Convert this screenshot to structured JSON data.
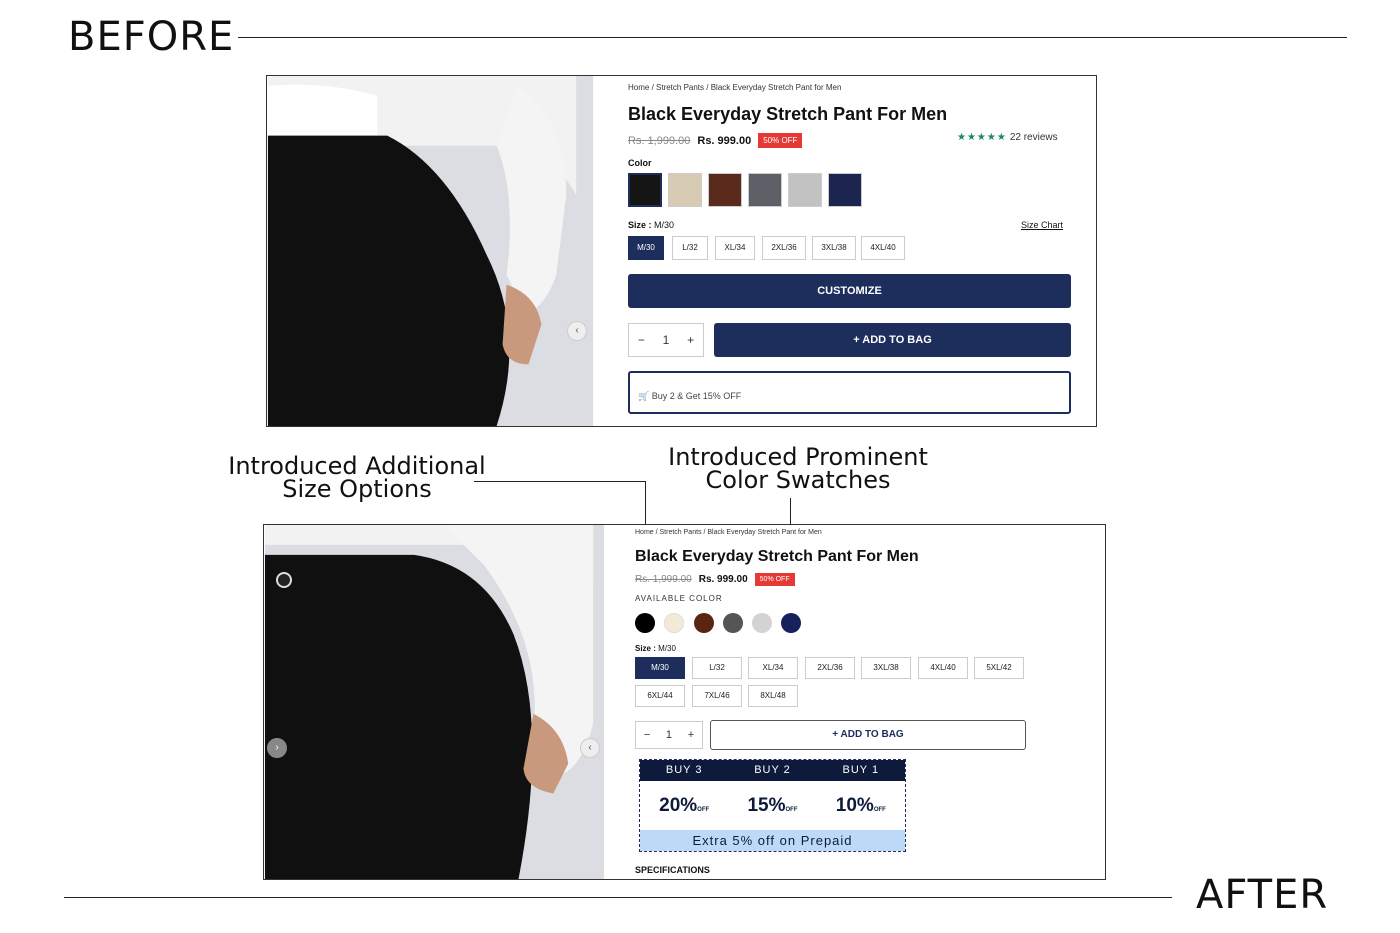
{
  "headings": {
    "before": "BEFORE",
    "after": "AFTER"
  },
  "annotations": {
    "sizes_line1": "Introduced Additional",
    "sizes_line2": "Size Options",
    "colors_line1": "Introduced Prominent",
    "colors_line2": "Color Swatches"
  },
  "before": {
    "breadcrumb": "Home / Stretch Pants / Black Everyday Stretch Pant for Men",
    "title": "Black Everyday Stretch Pant For Men",
    "old_price": "Rs. 1,999.00",
    "price": "Rs. 999.00",
    "badge": "50% OFF",
    "stars": "★★★★★",
    "reviews": "22 reviews",
    "color_label": "Color",
    "size_label": "Size :",
    "size_value": "M/30",
    "size_chart": "Size Chart",
    "sizes": [
      "M/30",
      "L/32",
      "XL/34",
      "2XL/36",
      "3XL/38",
      "4XL/40"
    ],
    "customize": "CUSTOMIZE",
    "qty": {
      "minus": "−",
      "value": "1",
      "plus": "+"
    },
    "add_to_bag": "+ ADD TO BAG",
    "offer": "🛒 Buy 2 & Get 15% OFF",
    "swatch_colors": [
      "#151515",
      "#d8cbb3",
      "#5a2a1c",
      "#5d6066",
      "#c2c2c2",
      "#1c2450"
    ]
  },
  "after": {
    "breadcrumb": "Home / Stretch Pants / Black Everyday Stretch Pant for Men",
    "title": "Black Everyday Stretch Pant For Men",
    "old_price": "Rs. 1,999.00",
    "price": "Rs. 999.00",
    "badge": "50% OFF",
    "color_label": "AVAILABLE COLOR",
    "color_dots": [
      "#000000",
      "#f1ebd6",
      "#5a2612",
      "#555555",
      "#d3d3d3",
      "#17215c"
    ],
    "size_label": "Size :",
    "size_value": "M/30",
    "sizes_row1": [
      "M/30",
      "L/32",
      "XL/34",
      "2XL/36",
      "3XL/38",
      "4XL/40",
      "5XL/42"
    ],
    "sizes_row2": [
      "6XL/44",
      "7XL/46",
      "8XL/48"
    ],
    "qty": {
      "minus": "−",
      "value": "1",
      "plus": "+"
    },
    "add_to_bag": "+ ADD TO BAG",
    "offers": [
      {
        "header": "BUY 3",
        "value": "20%",
        "off": "OFF"
      },
      {
        "header": "BUY 2",
        "value": "15%",
        "off": "OFF"
      },
      {
        "header": "BUY 1",
        "value": "10%",
        "off": "OFF"
      }
    ],
    "extra": "Extra 5% off on Prepaid",
    "specs": "SPECIFICATIONS"
  }
}
